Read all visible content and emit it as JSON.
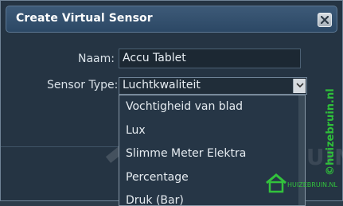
{
  "dialog": {
    "title": "Create Virtual Sensor"
  },
  "form": {
    "name_label": "Naam:",
    "name_value": "Accu Tablet",
    "sensor_type_label": "Sensor Type:",
    "sensor_type_selected": "Luchtkwaliteit"
  },
  "dropdown": {
    "options": [
      "Vochtigheid van blad",
      "Lux",
      "Slimme Meter Elektra",
      "Percentage",
      "Druk (Bar)"
    ]
  },
  "watermark": {
    "vertical_text": "©huizebruin.nl",
    "large_text": "HUIZEBRUIN.NL",
    "small_text": "HUIZEBRUIN.NL",
    "color": "#2fbf3a"
  },
  "icons": {
    "close": "close-icon",
    "dropdown_arrow": "chevron-down-icon",
    "logo": "house-logo-icon"
  }
}
